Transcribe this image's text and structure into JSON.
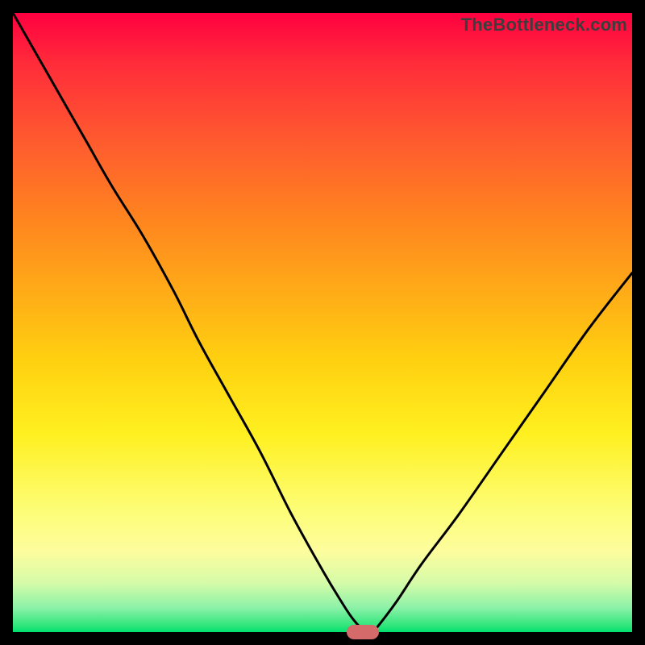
{
  "watermark": "TheBottleneck.com",
  "chart_data": {
    "type": "line",
    "title": "",
    "xlabel": "",
    "ylabel": "",
    "xlim": [
      0,
      100
    ],
    "ylim": [
      0,
      100
    ],
    "grid": false,
    "series": [
      {
        "name": "bottleneck-curve",
        "x": [
          0,
          4,
          8,
          12,
          16,
          21,
          26,
          30,
          35,
          40,
          45,
          50,
          53,
          55,
          57,
          58,
          59,
          62,
          66,
          72,
          79,
          86,
          93,
          100
        ],
        "values": [
          100,
          93,
          86,
          79,
          72,
          64,
          55,
          47,
          38,
          29,
          19,
          10,
          5,
          2,
          0,
          0,
          1,
          5,
          11,
          19,
          29,
          39,
          49,
          58
        ]
      }
    ],
    "annotations": [
      {
        "name": "min-marker",
        "x": 56.5,
        "y": 0,
        "color": "#d46a6a"
      }
    ],
    "background_gradient": {
      "type": "vertical",
      "stops": [
        {
          "pos": 0.0,
          "color": "#ff0040"
        },
        {
          "pos": 0.5,
          "color": "#ffc018"
        },
        {
          "pos": 0.8,
          "color": "#fdfd75"
        },
        {
          "pos": 0.96,
          "color": "#8df2a8"
        },
        {
          "pos": 1.0,
          "color": "#00e070"
        }
      ]
    }
  },
  "colors": {
    "frame": "#000000",
    "curve": "#000000",
    "marker": "#d46a6a",
    "watermark": "#3d3d3d"
  }
}
